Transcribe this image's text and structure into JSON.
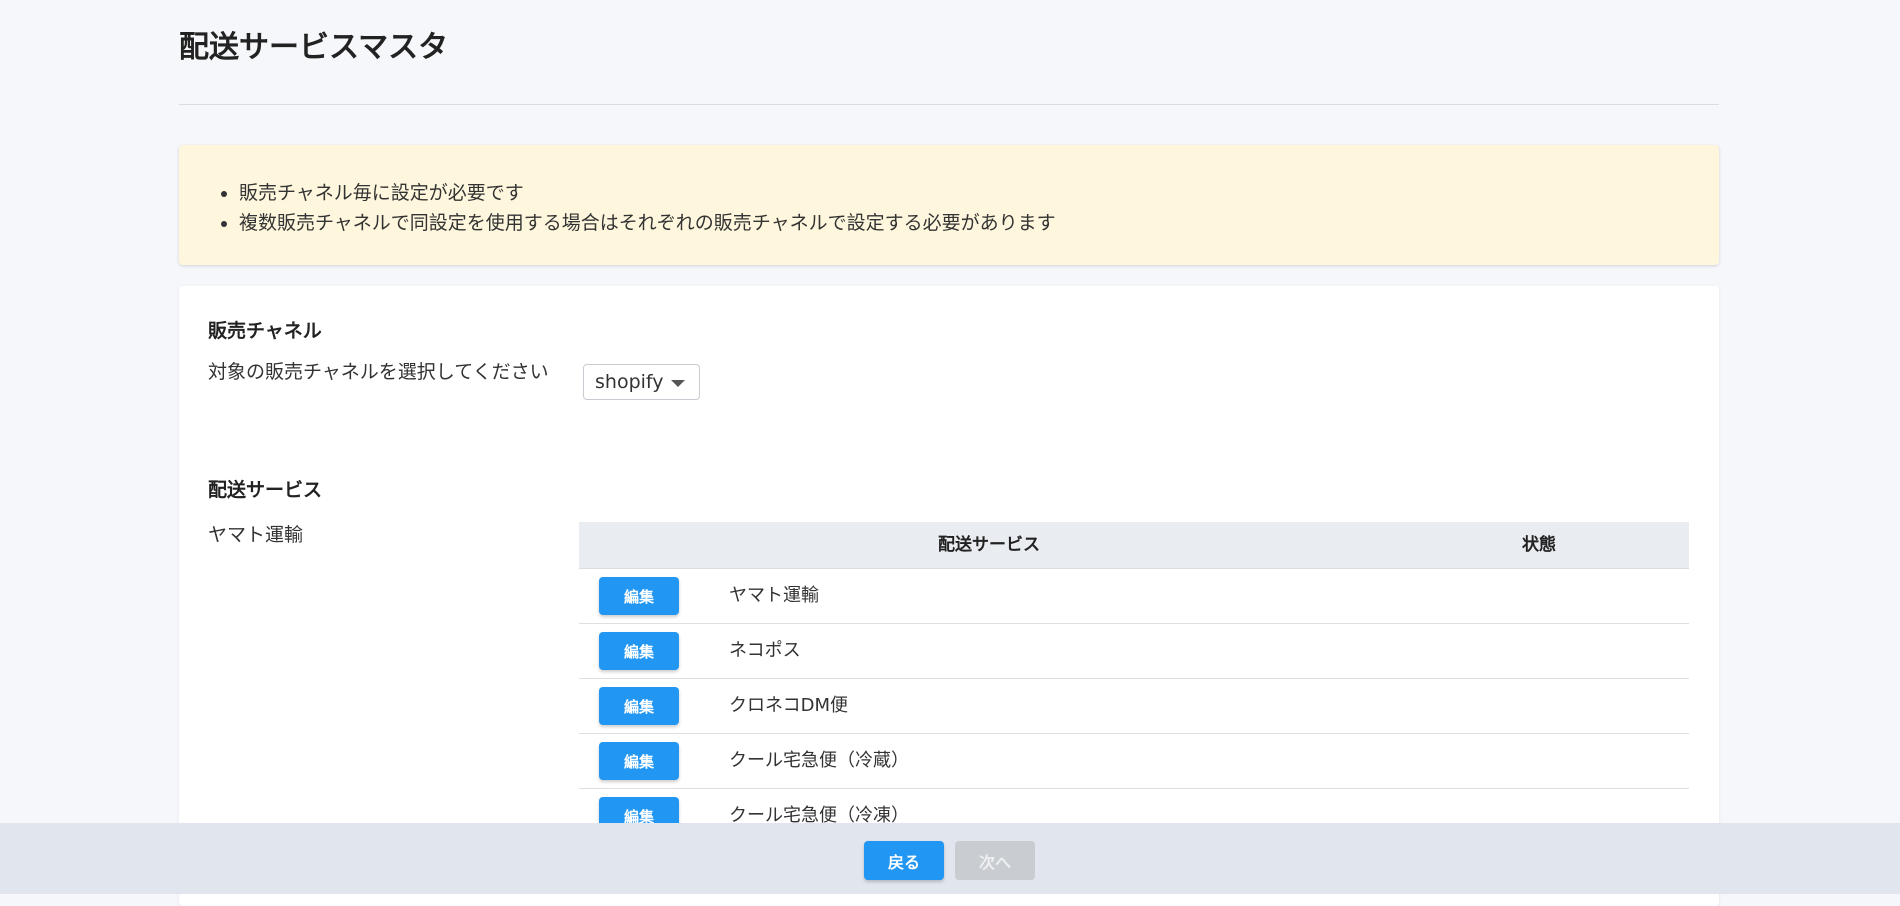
{
  "page": {
    "title": "配送サービスマスタ"
  },
  "notice": {
    "items": [
      "販売チャネル毎に設定が必要です",
      "複数販売チャネルで同設定を使用する場合はそれぞれの販売チャネルで設定する必要があります"
    ]
  },
  "channel_section": {
    "heading": "販売チャネル",
    "prompt": "対象の販売チャネルを選択してください",
    "select_value": "shopify"
  },
  "service_section": {
    "heading": "配送サービス",
    "carrier": "ヤマト運輸",
    "columns": {
      "service": "配送サービス",
      "status": "状態"
    },
    "edit_label": "編集",
    "rows": [
      {
        "name": "ヤマト運輸",
        "status": ""
      },
      {
        "name": "ネコポス",
        "status": ""
      },
      {
        "name": "クロネコDM便",
        "status": ""
      },
      {
        "name": "クール宅急便（冷蔵）",
        "status": ""
      },
      {
        "name": "クール宅急便（冷凍）",
        "status": ""
      }
    ]
  },
  "footer": {
    "back_label": "戻る",
    "next_label": "次へ"
  }
}
